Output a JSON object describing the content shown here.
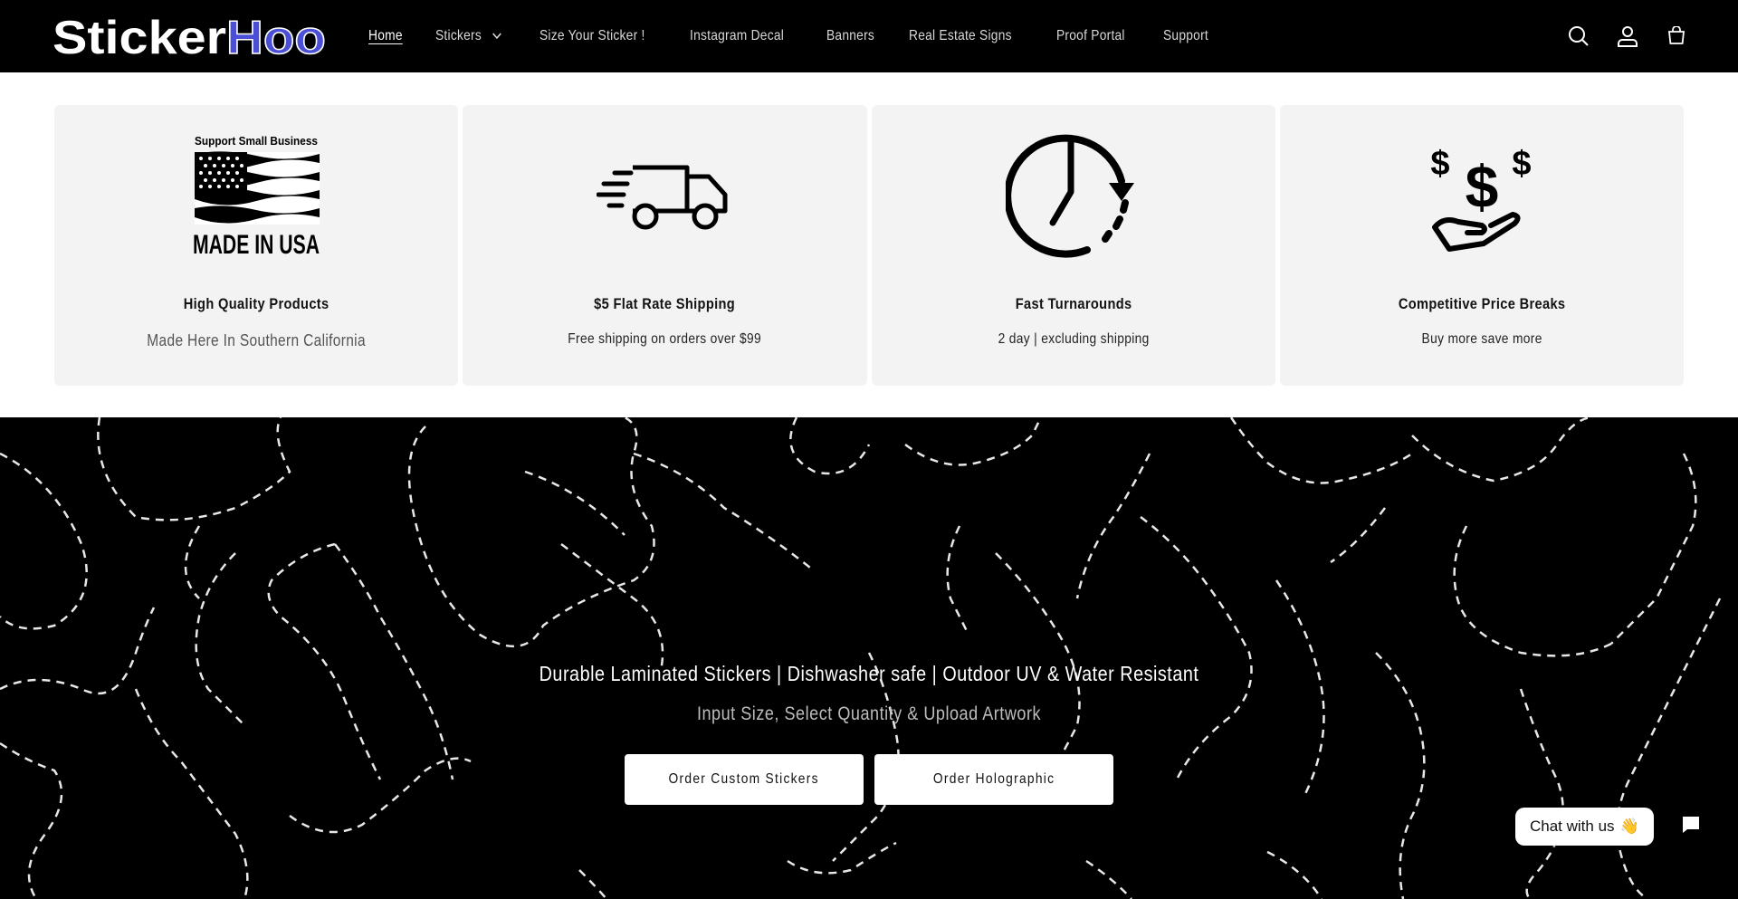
{
  "header": {
    "logo": {
      "part1": "Sticker",
      "part2": "Hoo"
    },
    "nav": [
      {
        "label": "Home",
        "active": true
      },
      {
        "label": "Stickers",
        "has_dropdown": true
      },
      {
        "label": "Size Your Sticker !"
      },
      {
        "label": "Instagram Decal"
      },
      {
        "label": "Banners"
      },
      {
        "label": "Real Estate Signs"
      },
      {
        "label": "Proof Portal"
      },
      {
        "label": "Support"
      }
    ],
    "icons": [
      "search-icon",
      "account-icon",
      "cart-icon"
    ]
  },
  "features": [
    {
      "icon": "made-in-usa-badge",
      "badge_top": "Support Small Business",
      "badge_bottom": "MADE IN USA",
      "title": "High Quality Products",
      "subtitle": "Made Here In Southern California"
    },
    {
      "icon": "delivery-truck-icon",
      "title": "$5 Flat Rate Shipping",
      "subtitle": "Free shipping on orders over $99"
    },
    {
      "icon": "clock-icon",
      "title": "Fast Turnarounds",
      "subtitle": "2 day | excluding shipping"
    },
    {
      "icon": "price-hand-icon",
      "title": "Competitive Price Breaks",
      "subtitle": "Buy more save more"
    }
  ],
  "hero": {
    "headline": "Durable Laminated Stickers | Dishwasher safe | Outdoor UV & Water Resistant",
    "subheadline": "Input Size, Select Quantity & Upload Artwork",
    "buttons": [
      {
        "label": "Order Custom Stickers"
      },
      {
        "label": "Order Holographic"
      }
    ]
  },
  "chat": {
    "label": "Chat with us",
    "emoji": "👋"
  },
  "colors": {
    "header_bg": "#000000",
    "logo_accent": "#4b4fd6",
    "card_bg": "#f3f3f3",
    "hero_bg": "#000000"
  }
}
